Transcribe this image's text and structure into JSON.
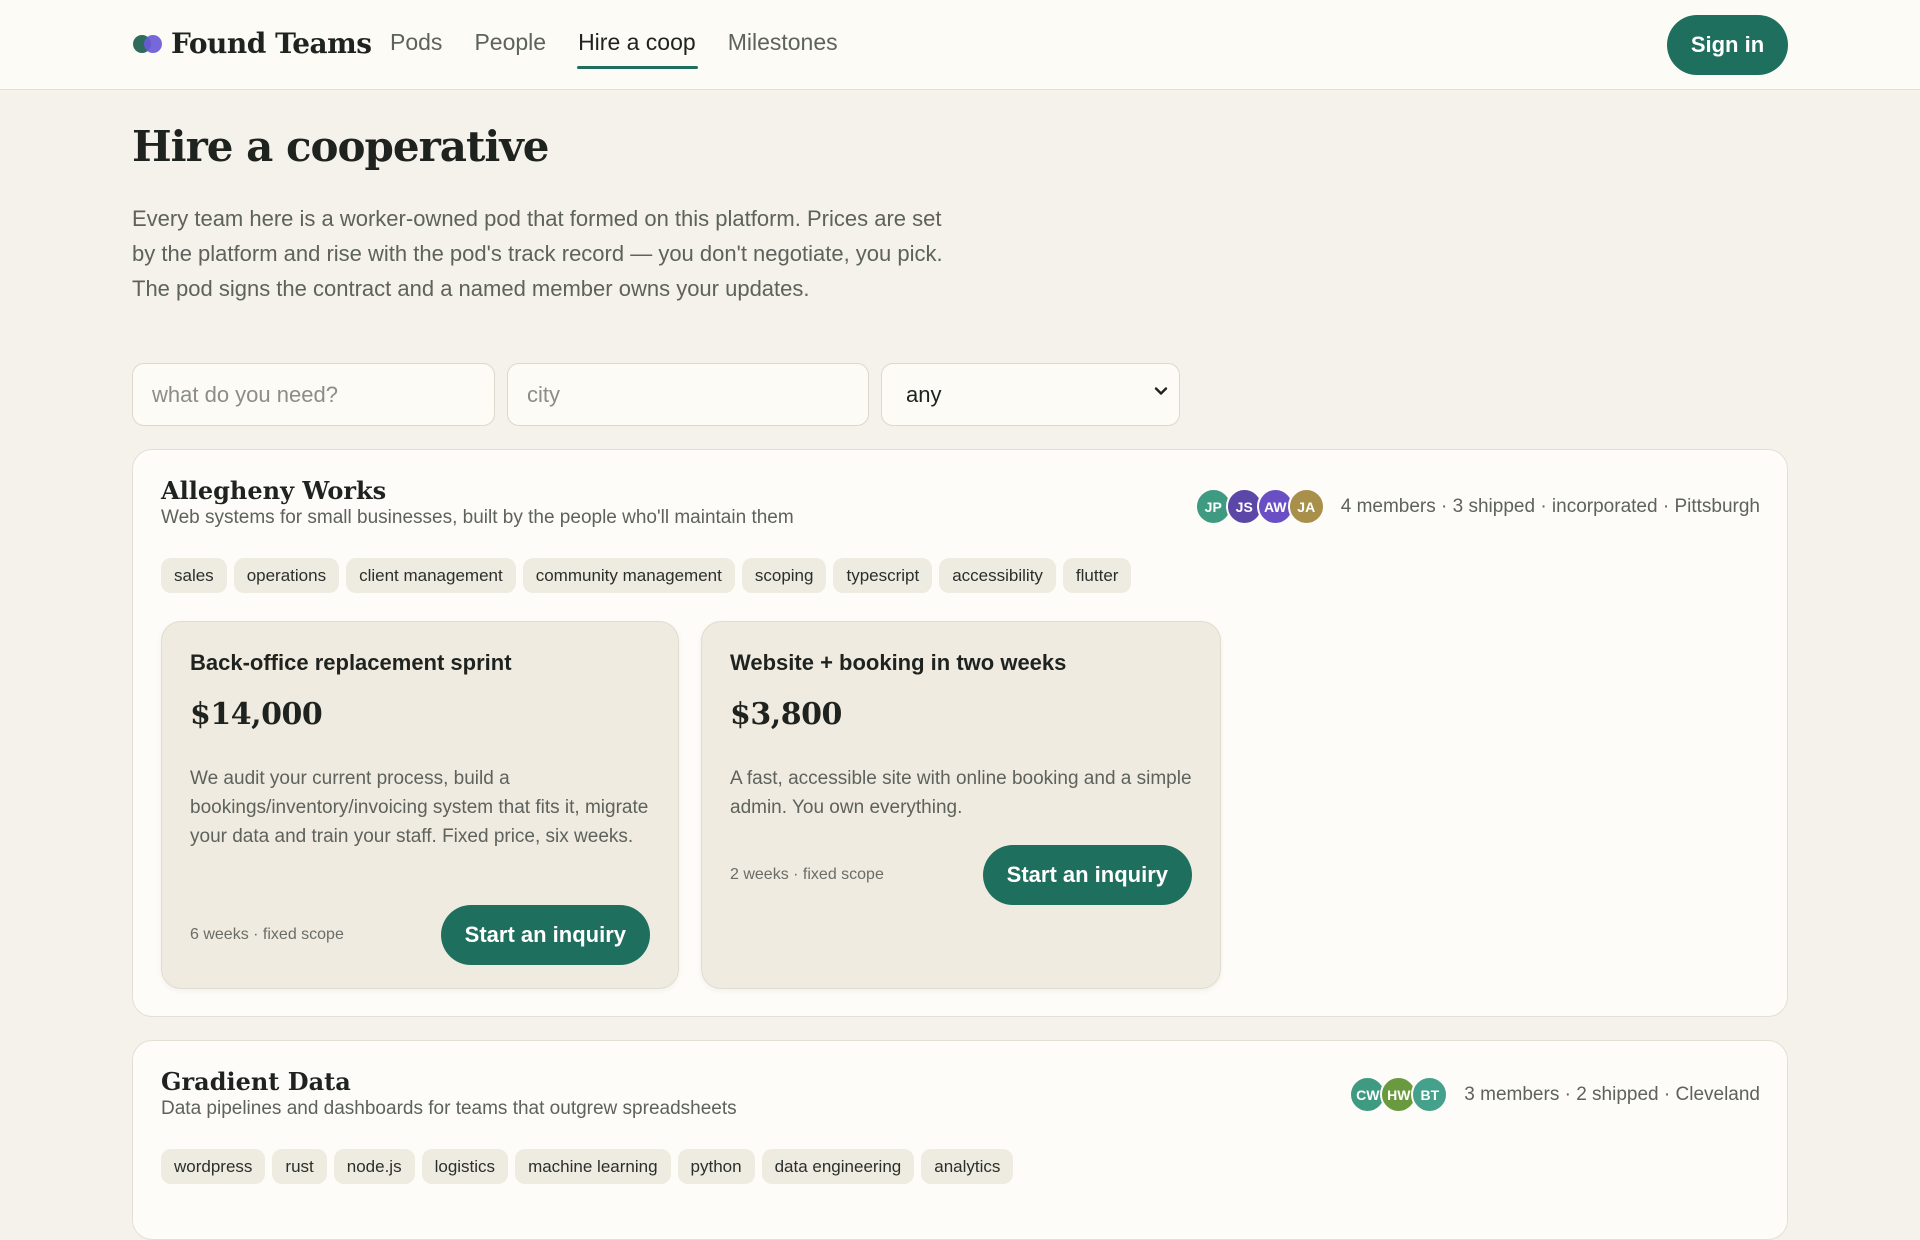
{
  "header": {
    "brand": "Found Teams",
    "nav": [
      "Pods",
      "People",
      "Hire a coop",
      "Milestones"
    ],
    "active_nav": "Hire a coop",
    "sign_in": "Sign in"
  },
  "page": {
    "title": "Hire a cooperative",
    "intro": "Every team here is a worker-owned pod that formed on this platform. Prices are set by the platform and rise with the pod's track record — you don't negotiate, you pick. The pod signs the contract and a named member owns your updates."
  },
  "filters": {
    "need_placeholder": "what do you need?",
    "need_value": "",
    "city_placeholder": "city",
    "city_value": "",
    "select_value": "any"
  },
  "colors": {
    "accent": "#1f6f5e",
    "background": "#f4f2ea"
  },
  "teams": [
    {
      "name": "Allegheny Works",
      "description": "Web systems for small businesses, built by the people who'll maintain them",
      "avatars": [
        {
          "initials": "JP",
          "color": "#3f9a82"
        },
        {
          "initials": "JS",
          "color": "#5a47a8"
        },
        {
          "initials": "AW",
          "color": "#6a4fc4"
        },
        {
          "initials": "JA",
          "color": "#a8904a"
        }
      ],
      "meta": "4 members · 3 shipped · incorporated · Pittsburgh",
      "tags": [
        "sales",
        "operations",
        "client management",
        "community management",
        "scoping",
        "typescript",
        "accessibility",
        "flutter"
      ],
      "offers": [
        {
          "title": "Back-office replacement sprint",
          "price": "$14,000",
          "description": "We audit your current process, build a bookings/inventory/invoicing system that fits it, migrate your data and train your staff. Fixed price, six weeks.",
          "scope": "6 weeks · fixed scope",
          "cta": "Start an inquiry"
        },
        {
          "title": "Website + booking in two weeks",
          "price": "$3,800",
          "description": "A fast, accessible site with online booking and a simple admin. You own everything.",
          "scope": "2 weeks · fixed scope",
          "cta": "Start an inquiry"
        }
      ]
    },
    {
      "name": "Gradient Data",
      "description": "Data pipelines and dashboards for teams that outgrew spreadsheets",
      "avatars": [
        {
          "initials": "CW",
          "color": "#3f9a82"
        },
        {
          "initials": "HW",
          "color": "#6a9a3f"
        },
        {
          "initials": "BT",
          "color": "#45a08c"
        }
      ],
      "meta": "3 members · 2 shipped · Cleveland",
      "tags": [
        "wordpress",
        "rust",
        "node.js",
        "logistics",
        "machine learning",
        "python",
        "data engineering",
        "analytics"
      ]
    }
  ]
}
